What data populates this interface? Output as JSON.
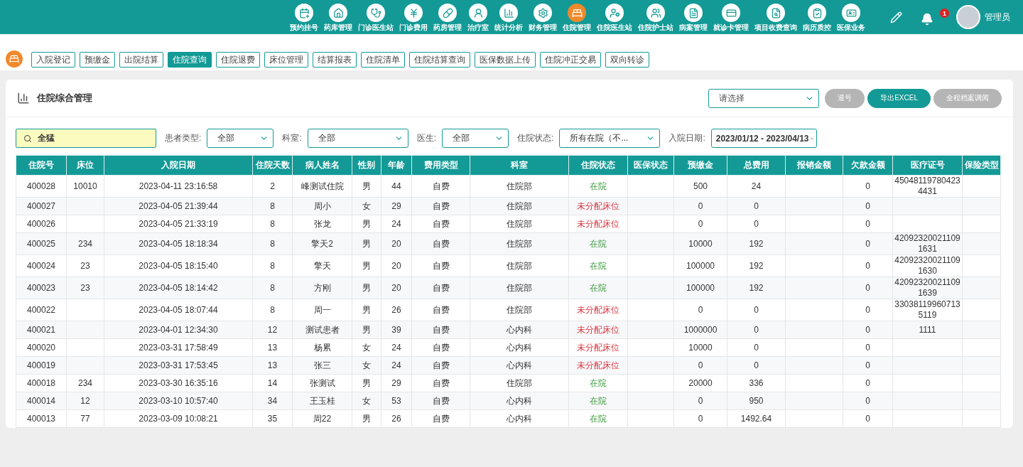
{
  "nav": {
    "items": [
      {
        "label": "预约挂号",
        "selected": false
      },
      {
        "label": "药库管理",
        "selected": false
      },
      {
        "label": "门诊医生站",
        "selected": false
      },
      {
        "label": "门诊费用",
        "selected": false
      },
      {
        "label": "药房管理",
        "selected": false
      },
      {
        "label": "治疗室",
        "selected": false
      },
      {
        "label": "统计分析",
        "selected": false
      },
      {
        "label": "财务管理",
        "selected": false
      },
      {
        "label": "住院管理",
        "selected": true
      },
      {
        "label": "住院医生站",
        "selected": false
      },
      {
        "label": "住院护士站",
        "selected": false
      },
      {
        "label": "病案管理",
        "selected": false
      },
      {
        "label": "就诊卡管理",
        "selected": false
      },
      {
        "label": "项目收费查询",
        "selected": false
      },
      {
        "label": "病历质控",
        "selected": false
      },
      {
        "label": "医保业务",
        "selected": false
      }
    ],
    "notification_count": "1",
    "user": "管理员"
  },
  "tabs": [
    {
      "label": "入院登记",
      "selected": false
    },
    {
      "label": "预缴金",
      "selected": false
    },
    {
      "label": "出院结算",
      "selected": false
    },
    {
      "label": "住院查询",
      "selected": true
    },
    {
      "label": "住院退费",
      "selected": false
    },
    {
      "label": "床位管理",
      "selected": false
    },
    {
      "label": "结算报表",
      "selected": false
    },
    {
      "label": "住院清单",
      "selected": false
    },
    {
      "label": "住院结算查询",
      "selected": false
    },
    {
      "label": "医保数据上传",
      "selected": false
    },
    {
      "label": "住院冲正交易",
      "selected": false
    },
    {
      "label": "双向转诊",
      "selected": false
    }
  ],
  "panel": {
    "title": "住院综合管理",
    "select_placeholder": "请选择",
    "buttons": [
      {
        "label": "退号",
        "disabled": true
      },
      {
        "label": "导出EXCEL",
        "disabled": false
      },
      {
        "label": "全程档案调阅",
        "disabled": true
      }
    ]
  },
  "filters": {
    "search": "全猛",
    "selects": [
      {
        "label": "患者类型:",
        "value": "全部"
      },
      {
        "label": "科室:",
        "value": "全部"
      },
      {
        "label": "医生:",
        "value": "全部"
      },
      {
        "label": "住院状态:",
        "value": "所有在院（不..."
      }
    ],
    "date_label": "入院日期:",
    "date_value": "2023/01/12 - 2023/04/13"
  },
  "table": {
    "columns": [
      "住院号",
      "床位",
      "入院日期",
      "住院天数",
      "病人姓名",
      "性别",
      "年龄",
      "费用类型",
      "科室",
      "住院状态",
      "医保状态",
      "预缴金",
      "总费用",
      "报销金额",
      "欠款金额",
      "医疗证号",
      "保险类型"
    ],
    "rows": [
      {
        "kind": "admitted",
        "id": "400028",
        "bed": "10010",
        "date": "2023-04-11 23:16:58",
        "days": "2",
        "name": "峰测试住院",
        "sex": "男",
        "age": "44",
        "fee": "自费",
        "dept": "住院部",
        "status": "在院",
        "deposit": "500",
        "total": "24",
        "arrears": "0",
        "card": "450481197804234431"
      },
      {
        "kind": "unassigned",
        "id": "400027",
        "date": "2023-04-05 21:39:44",
        "days": "8",
        "name": "周小",
        "sex": "女",
        "age": "29",
        "fee": "自费",
        "dept": "住院部",
        "status": "未分配床位",
        "deposit": "0",
        "total": "0",
        "arrears": "0"
      },
      {
        "kind": "unassigned",
        "id": "400026",
        "date": "2023-04-05 21:33:19",
        "days": "8",
        "name": "张龙",
        "sex": "男",
        "age": "24",
        "fee": "自费",
        "dept": "住院部",
        "status": "未分配床位",
        "deposit": "0",
        "total": "0",
        "arrears": "0"
      },
      {
        "kind": "admitted",
        "id": "400025",
        "bed": "234",
        "date": "2023-04-05 18:18:34",
        "days": "8",
        "name": "擎天2",
        "sex": "男",
        "age": "20",
        "fee": "自费",
        "dept": "住院部",
        "status": "在院",
        "deposit": "10000",
        "total": "192",
        "arrears": "0",
        "card": "420923200211091631"
      },
      {
        "kind": "admitted",
        "id": "400024",
        "bed": "23",
        "date": "2023-04-05 18:15:40",
        "days": "8",
        "name": "擎天",
        "sex": "男",
        "age": "20",
        "fee": "自费",
        "dept": "住院部",
        "status": "在院",
        "deposit": "100000",
        "total": "192",
        "arrears": "0",
        "card": "420923200211091630"
      },
      {
        "kind": "admitted",
        "id": "400023",
        "bed": "23",
        "date": "2023-04-05 18:14:42",
        "days": "8",
        "name": "方刚",
        "sex": "男",
        "age": "20",
        "fee": "自费",
        "dept": "住院部",
        "status": "在院",
        "deposit": "100000",
        "total": "192",
        "arrears": "0",
        "card": "420923200211091639"
      },
      {
        "kind": "unassigned",
        "id": "400022",
        "date": "2023-04-05 18:07:44",
        "days": "8",
        "name": "周一",
        "sex": "男",
        "age": "26",
        "fee": "自费",
        "dept": "住院部",
        "status": "未分配床位",
        "deposit": "0",
        "total": "0",
        "arrears": "0",
        "card": "330381199607135119"
      },
      {
        "kind": "unassigned",
        "id": "400021",
        "date": "2023-04-01 12:34:30",
        "days": "12",
        "name": "测试患者",
        "sex": "男",
        "age": "39",
        "fee": "自费",
        "dept": "心内科",
        "status": "未分配床位",
        "deposit": "1000000",
        "total": "0",
        "arrears": "0",
        "card": "1111"
      },
      {
        "kind": "unassigned",
        "id": "400020",
        "date": "2023-03-31 17:58:49",
        "days": "13",
        "name": "杨累",
        "sex": "女",
        "age": "24",
        "fee": "自费",
        "dept": "心内科",
        "status": "未分配床位",
        "deposit": "10000",
        "total": "0",
        "arrears": "0"
      },
      {
        "kind": "unassigned",
        "id": "400019",
        "date": "2023-03-31 17:53:45",
        "days": "13",
        "name": "张三",
        "sex": "女",
        "age": "24",
        "fee": "自费",
        "dept": "心内科",
        "status": "未分配床位",
        "deposit": "0",
        "total": "0",
        "arrears": "0"
      },
      {
        "kind": "admitted",
        "id": "400018",
        "bed": "234",
        "date": "2023-03-30 16:35:16",
        "days": "14",
        "name": "张测试",
        "sex": "男",
        "age": "29",
        "fee": "自费",
        "dept": "住院部",
        "status": "在院",
        "deposit": "20000",
        "total": "336",
        "arrears": "0"
      },
      {
        "kind": "admitted",
        "id": "400014",
        "bed": "12",
        "date": "2023-03-10 10:57:40",
        "days": "34",
        "name": "王玉桂",
        "sex": "女",
        "age": "53",
        "fee": "自费",
        "dept": "心内科",
        "status": "在院",
        "deposit": "0",
        "total": "950",
        "arrears": "0"
      },
      {
        "kind": "admitted",
        "id": "400013",
        "bed": "77",
        "date": "2023-03-09 10:08:21",
        "days": "35",
        "name": "周22",
        "sex": "男",
        "age": "26",
        "fee": "自费",
        "dept": "心内科",
        "status": "在院",
        "deposit": "0",
        "total": "1492.64",
        "arrears": "0"
      }
    ]
  }
}
